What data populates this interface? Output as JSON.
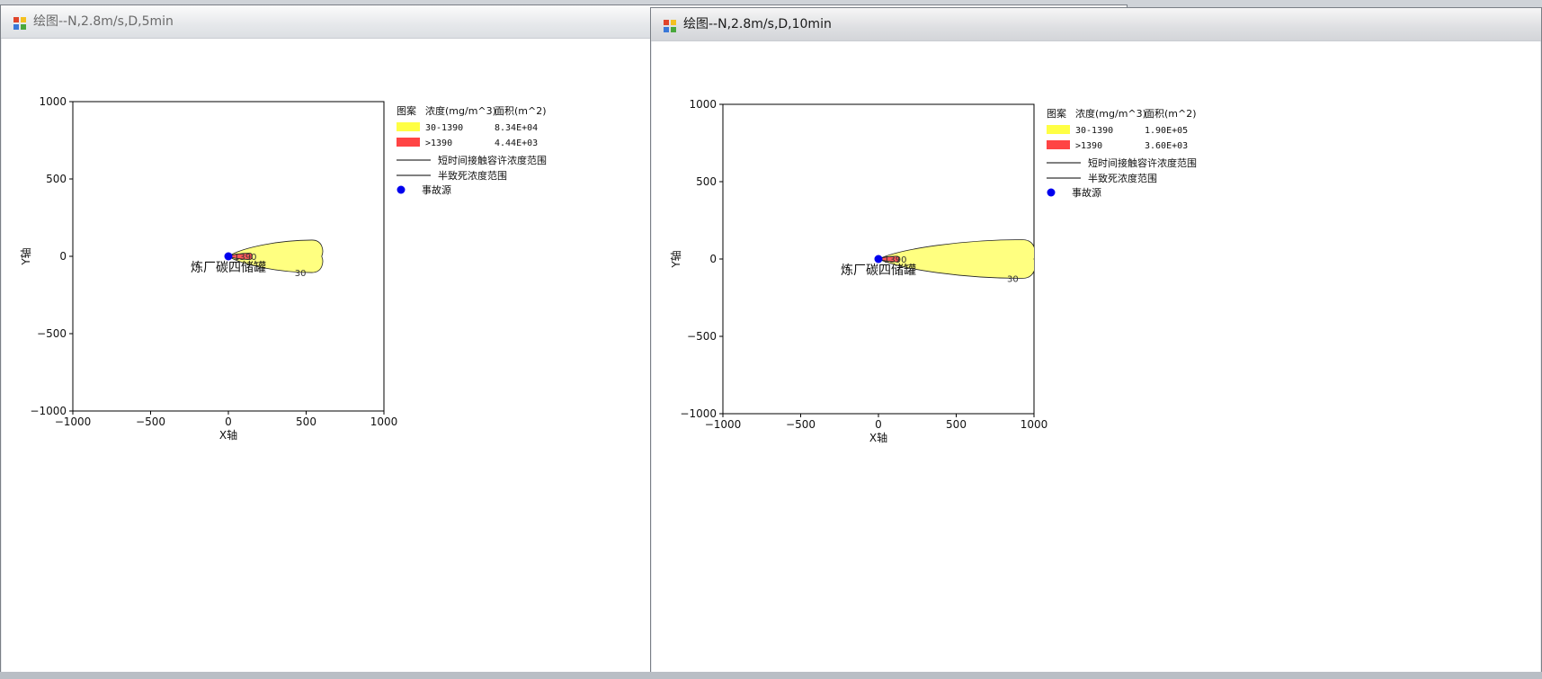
{
  "windows": [
    {
      "title": "绘图--N,2.8m/s,D,5min",
      "x_ticks": [
        "−1000",
        "−500",
        "0",
        "500",
        "1000"
      ],
      "y_ticks": [
        "1000",
        "500",
        "0",
        "−500",
        "−1000"
      ],
      "x_label": "X轴",
      "y_label": "Y轴",
      "source_label": "炼厂碳四储罐",
      "legend": {
        "header_pattern": "图案",
        "header_conc": "浓度(mg/m^3)",
        "header_area": "面积(m^2)",
        "row1_range": "30-1390",
        "row1_area": "8.34E+04",
        "row2_range": ">1390",
        "row2_area": "4.44E+03",
        "line1": "短时间接触容许浓度范围",
        "line2": "半致死浓度范围",
        "source": "事故源"
      },
      "contour_labels": {
        "outer": "30",
        "inner": "1390"
      },
      "chart_data": {
        "type": "area",
        "xlim": [
          -1000,
          1000
        ],
        "ylim": [
          -1000,
          1000
        ],
        "source": {
          "x": 0,
          "y": 0
        },
        "plume_outer": {
          "x_start": 0,
          "x_end": 600,
          "half_width": 105
        },
        "plume_inner": {
          "x_start": 0,
          "x_end": 150,
          "half_width": 20
        }
      }
    },
    {
      "title": "绘图--N,2.8m/s,D,10min",
      "x_ticks": [
        "−1000",
        "−500",
        "0",
        "500",
        "1000"
      ],
      "y_ticks": [
        "1000",
        "500",
        "0",
        "−500",
        "−1000"
      ],
      "x_label": "X轴",
      "y_label": "Y轴",
      "source_label": "炼厂碳四储罐",
      "legend": {
        "header_pattern": "图案",
        "header_conc": "浓度(mg/m^3)",
        "header_area": "面积(m^2)",
        "row1_range": "30-1390",
        "row1_area": "1.90E+05",
        "row2_range": ">1390",
        "row2_area": "3.60E+03",
        "line1": "短时间接触容许浓度范围",
        "line2": "半致死浓度范围",
        "source": "事故源"
      },
      "contour_labels": {
        "outer": "30",
        "inner": "1390"
      },
      "chart_data": {
        "type": "area",
        "xlim": [
          -1000,
          1000
        ],
        "ylim": [
          -1000,
          1000
        ],
        "source": {
          "x": 0,
          "y": 0
        },
        "plume_outer": {
          "x_start": 0,
          "x_end": 1000,
          "half_width": 125
        },
        "plume_inner": {
          "x_start": 0,
          "x_end": 130,
          "half_width": 18
        }
      }
    }
  ],
  "colors": {
    "yellow_fill": "#ffff80",
    "legend_yellow": "#ffff44",
    "legend_red": "#ff4444",
    "red_fill": "#ff5a5a",
    "source_dot": "#0000ee"
  }
}
